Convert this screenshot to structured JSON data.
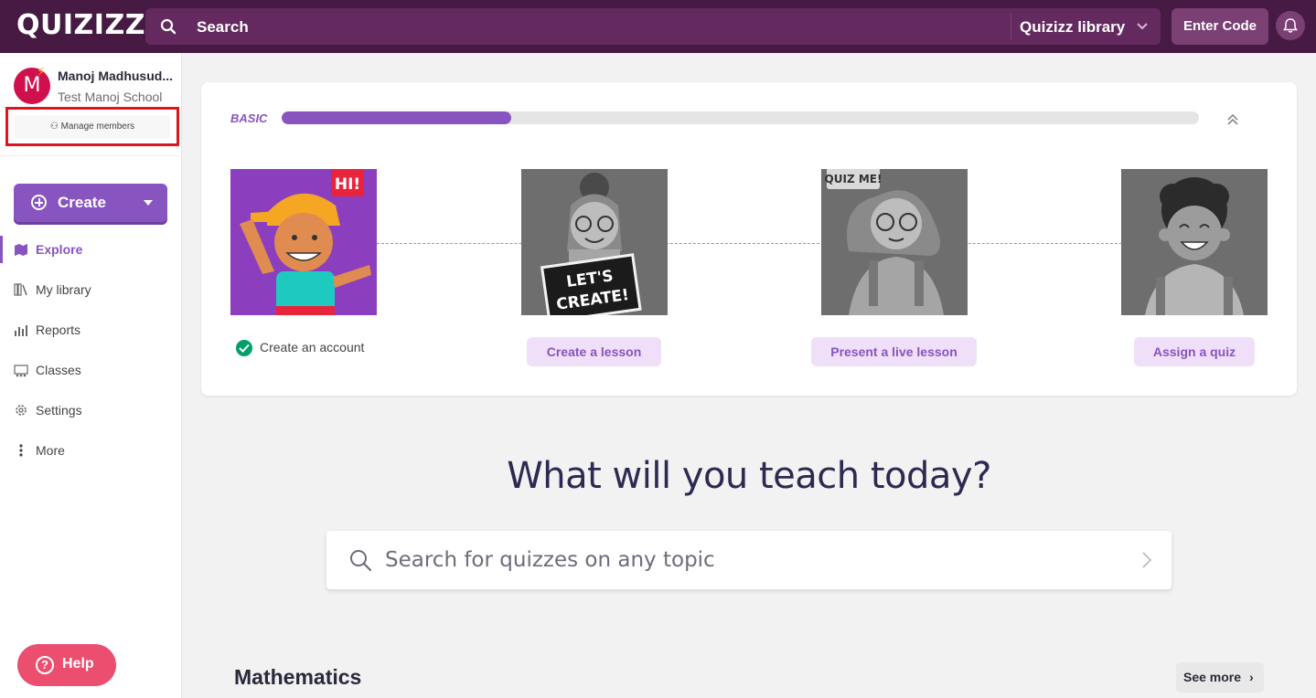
{
  "topbar": {
    "logo": "QUIZIZZ",
    "search_label": "Search",
    "library_label": "Quizizz library",
    "enter_code": "Enter Code"
  },
  "sidebar": {
    "avatar_initial": "M",
    "user_name": "Manoj Madhusud...",
    "school": "Test Manoj School",
    "manage_members": "Manage members",
    "create_label": "Create",
    "nav": [
      {
        "label": "Explore",
        "icon": "explore-icon",
        "active": true
      },
      {
        "label": "My library",
        "icon": "library-icon",
        "active": false
      },
      {
        "label": "Reports",
        "icon": "reports-icon",
        "active": false
      },
      {
        "label": "Classes",
        "icon": "classes-icon",
        "active": false
      },
      {
        "label": "Settings",
        "icon": "settings-icon",
        "active": false
      },
      {
        "label": "More",
        "icon": "more-icon",
        "active": false
      }
    ],
    "help_label": "Help"
  },
  "progress": {
    "level": "BASIC",
    "fraction": 0.25,
    "steps": [
      {
        "label": "Create an account",
        "done": true,
        "badge": "HI!"
      },
      {
        "label": "Create a lesson",
        "done": false,
        "badge": "LET'S CREATE!"
      },
      {
        "label": "Present a live lesson",
        "done": false,
        "badge": "QUIZ ME!"
      },
      {
        "label": "Assign a quiz",
        "done": false,
        "badge": ""
      }
    ]
  },
  "main": {
    "headline": "What will you teach today?",
    "search_placeholder": "Search for quizzes on any topic",
    "section_title": "Mathematics",
    "see_more": "See more"
  },
  "colors": {
    "topbar": "#461a42",
    "accent": "#8854c0",
    "help": "#ec4e70",
    "highlight": "#e0141e"
  }
}
